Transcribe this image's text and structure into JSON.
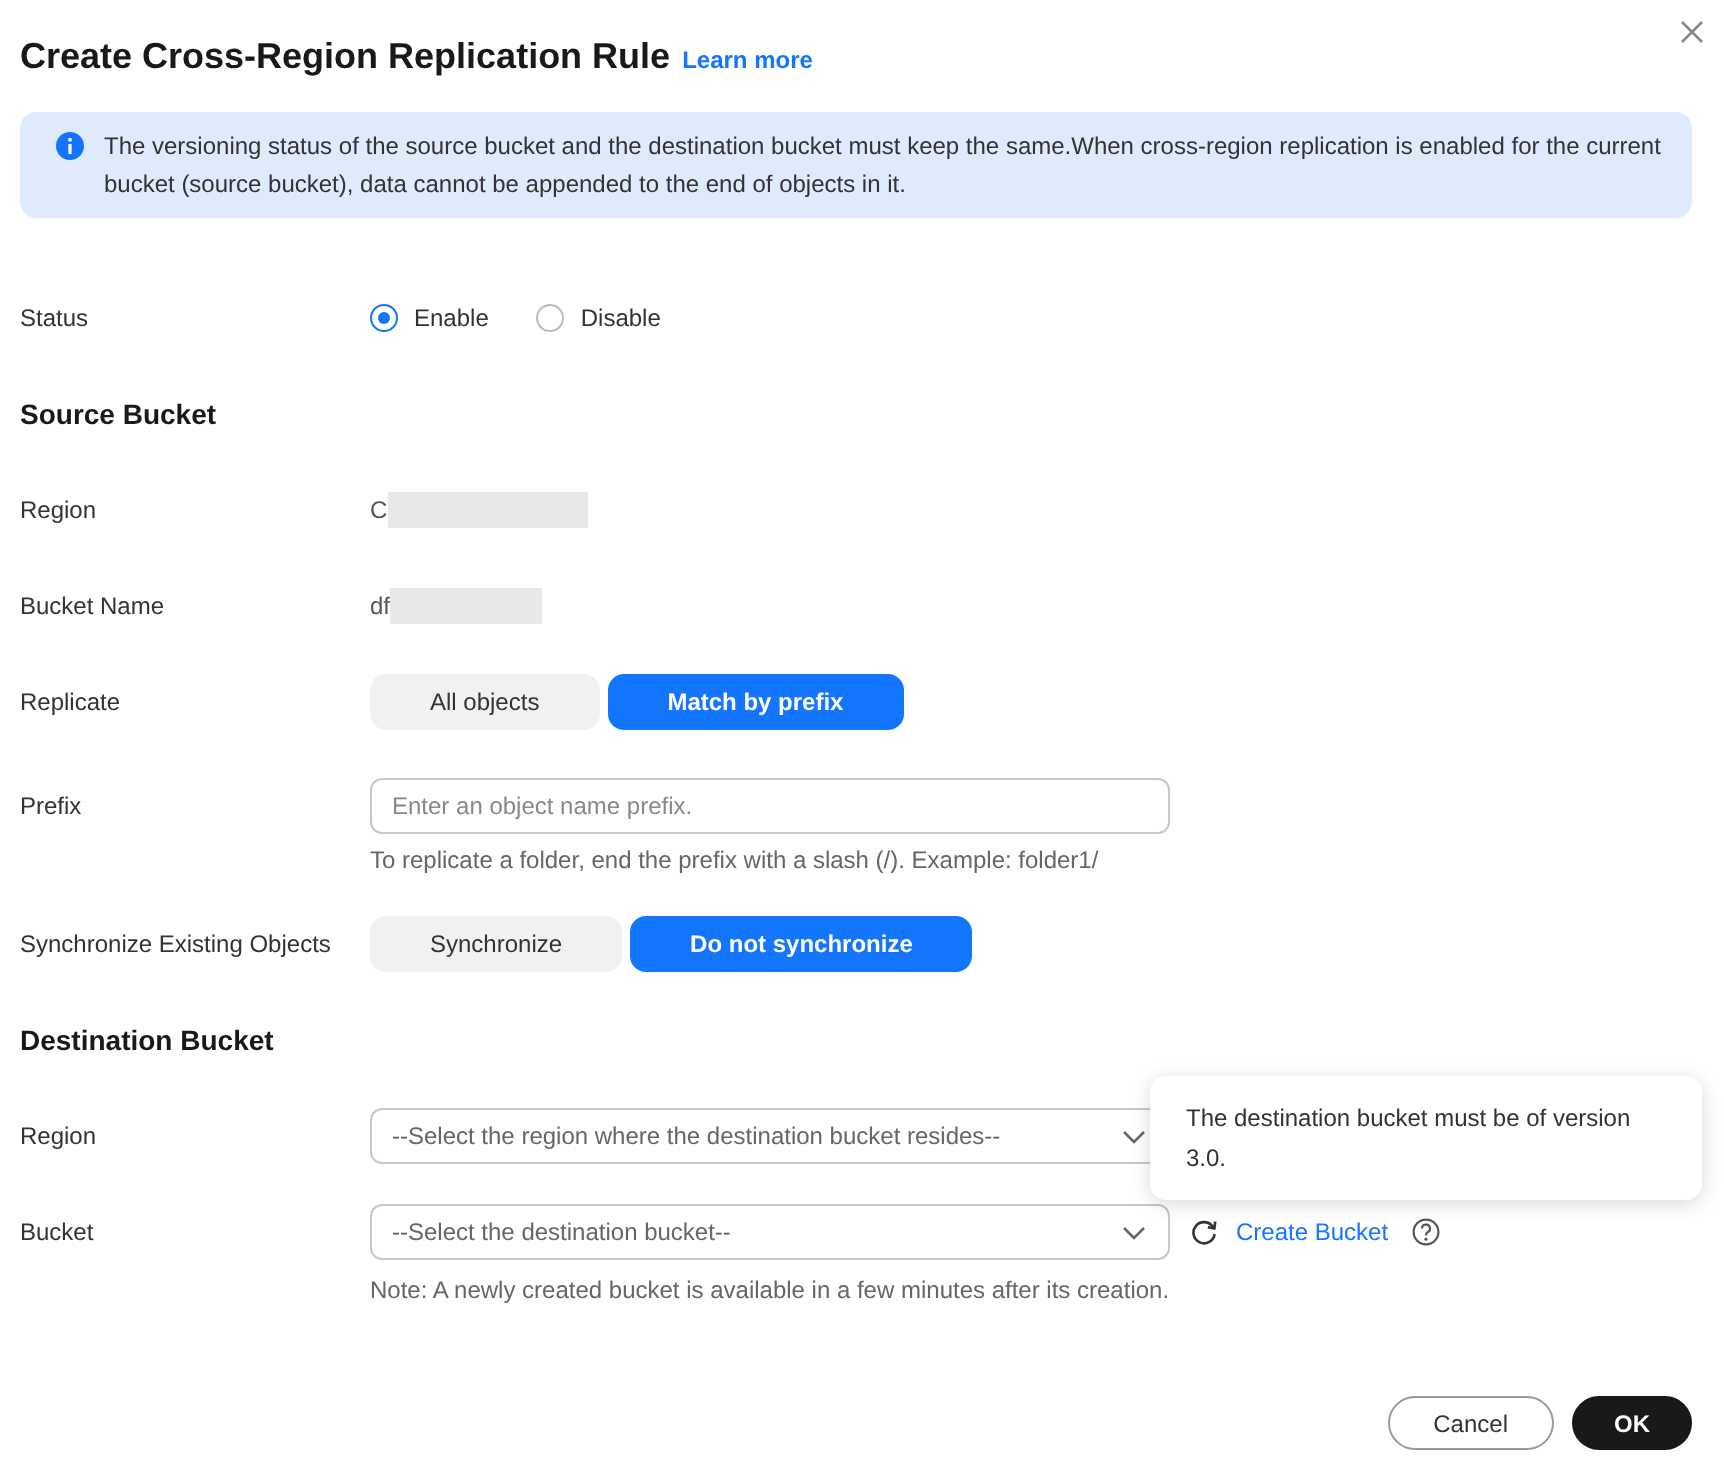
{
  "dialog": {
    "title": "Create Cross-Region Replication Rule",
    "learn_more": "Learn more"
  },
  "notice": "The versioning status of the source bucket and the destination bucket must keep the same.When cross-region replication is enabled for the current bucket (source bucket), data cannot be appended to the end of objects in it.",
  "status": {
    "label": "Status",
    "options": [
      {
        "label": "Enable",
        "selected": true
      },
      {
        "label": "Disable",
        "selected": false
      }
    ]
  },
  "source_bucket": {
    "heading": "Source Bucket",
    "region": {
      "label": "Region",
      "value": "C"
    },
    "bucket_name": {
      "label": "Bucket Name",
      "value": "df"
    },
    "replicate": {
      "label": "Replicate",
      "options": [
        {
          "label": "All objects",
          "selected": false
        },
        {
          "label": "Match by prefix",
          "selected": true
        }
      ]
    },
    "prefix": {
      "label": "Prefix",
      "placeholder": "Enter an object name prefix.",
      "hint": "To replicate a folder, end the prefix with a slash (/). Example: folder1/"
    },
    "synchronize": {
      "label": "Synchronize Existing Objects",
      "options": [
        {
          "label": "Synchronize",
          "selected": false
        },
        {
          "label": "Do not synchronize",
          "selected": true
        }
      ]
    }
  },
  "destination_bucket": {
    "heading": "Destination Bucket",
    "region": {
      "label": "Region",
      "placeholder": "--Select the region where the destination bucket resides--"
    },
    "bucket": {
      "label": "Bucket",
      "placeholder": "--Select the destination bucket--",
      "create_link": "Create Bucket",
      "note": "Note: A newly created bucket is available in a few minutes after its creation."
    },
    "tooltip": "The destination bucket must be of version 3.0."
  },
  "buttons": [
    {
      "label": "Cancel",
      "kind": "secondary"
    },
    {
      "label": "OK",
      "kind": "primary"
    }
  ]
}
